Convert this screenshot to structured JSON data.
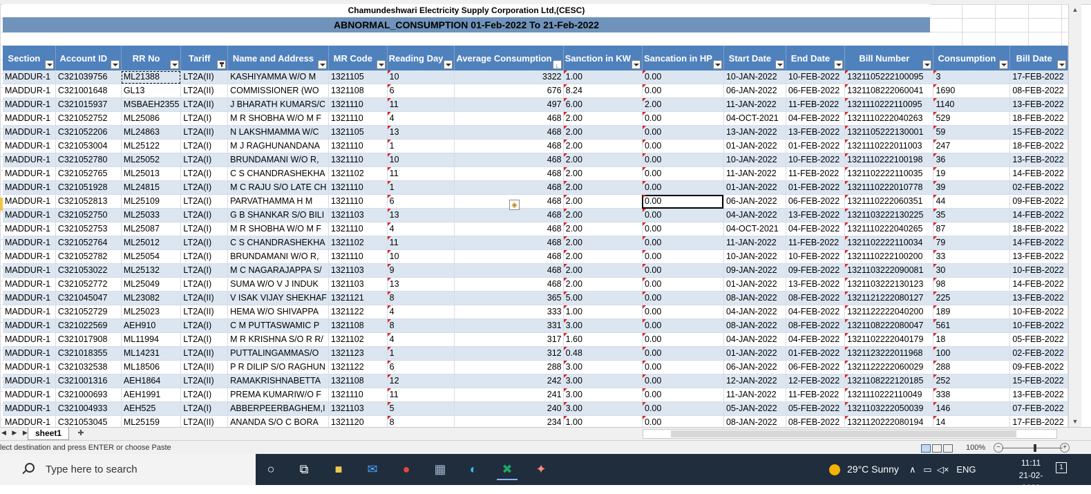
{
  "report": {
    "company": "Chamundeshwari Electricity Supply Corporation Ltd,(CESC)",
    "title": "ABNORMAL_CONSUMPTION 01-Feb-2022 To 21-Feb-2022"
  },
  "columns": [
    {
      "label": "Section",
      "filter": "normal"
    },
    {
      "label": "Account ID",
      "filter": "normal"
    },
    {
      "label": "RR No",
      "filter": "normal"
    },
    {
      "label": "Tariff",
      "filter": "active"
    },
    {
      "label": "Name and Address",
      "filter": "normal"
    },
    {
      "label": "MR Code",
      "filter": "normal"
    },
    {
      "label": "Reading Day",
      "filter": "normal"
    },
    {
      "label": "Average Consumption",
      "filter": "sorted"
    },
    {
      "label": "Sanction in KW",
      "filter": "normal"
    },
    {
      "label": "Sancation in HP",
      "filter": "normal"
    },
    {
      "label": "Start Date",
      "filter": "normal"
    },
    {
      "label": "End Date",
      "filter": "normal"
    },
    {
      "label": "Bill Number",
      "filter": "normal"
    },
    {
      "label": "Consumption",
      "filter": "normal"
    },
    {
      "label": "Bill Date",
      "filter": "normal"
    }
  ],
  "rows": [
    [
      "MADDUR-1",
      "C321039756",
      "ML21388",
      "LT2A(II)",
      "KASHIYAMMA W/O M",
      "1321105",
      "10",
      "3322",
      "1.00",
      "0.00",
      "10-JAN-2022",
      "10-FEB-2022",
      "1321105222100095",
      "3",
      "17-FEB-2022"
    ],
    [
      "MADDUR-1",
      "C321001648",
      "GL13",
      "LT2A(II)",
      "COMMISSIONER (WO",
      "1321108",
      "6",
      "676",
      "8.24",
      "0.00",
      "06-JAN-2022",
      "06-FEB-2022",
      "1321108222060041",
      "1690",
      "08-FEB-2022"
    ],
    [
      "MADDUR-1",
      "C321015937",
      "MSBAEH2355",
      "LT2A(II)",
      "J BHARATH KUMARS/C",
      "1321110",
      "11",
      "497",
      "6.00",
      "2.00",
      "11-JAN-2022",
      "11-FEB-2022",
      "1321110222110095",
      "1140",
      "13-FEB-2022"
    ],
    [
      "MADDUR-1",
      "C321052752",
      "ML25086",
      "LT2A(I)",
      "M R SHOBHA W/O M F",
      "1321110",
      "4",
      "468",
      "2.00",
      "0.00",
      "04-OCT-2021",
      "04-FEB-2022",
      "1321110222040263",
      "529",
      "18-FEB-2022"
    ],
    [
      "MADDUR-1",
      "C321052206",
      "ML24863",
      "LT2A(II)",
      "N LAKSHMAMMA W/C",
      "1321105",
      "13",
      "468",
      "2.00",
      "0.00",
      "13-JAN-2022",
      "13-FEB-2022",
      "1321105222130001",
      "59",
      "15-FEB-2022"
    ],
    [
      "MADDUR-1",
      "C321053004",
      "ML25122",
      "LT2A(I)",
      "M J RAGHUNANDANA",
      "1321110",
      "1",
      "468",
      "2.00",
      "0.00",
      "01-JAN-2022",
      "01-FEB-2022",
      "1321110222011003",
      "247",
      "18-FEB-2022"
    ],
    [
      "MADDUR-1",
      "C321052780",
      "ML25052",
      "LT2A(I)",
      "BRUNDAMANI W/O R,",
      "1321110",
      "10",
      "468",
      "2.00",
      "0.00",
      "10-JAN-2022",
      "10-FEB-2022",
      "1321110222100198",
      "36",
      "13-FEB-2022"
    ],
    [
      "MADDUR-1",
      "C321052765",
      "ML25013",
      "LT2A(I)",
      "C S CHANDRASHEKHA",
      "1321102",
      "11",
      "468",
      "2.00",
      "0.00",
      "11-JAN-2022",
      "11-FEB-2022",
      "1321102222110035",
      "19",
      "14-FEB-2022"
    ],
    [
      "MADDUR-1",
      "C321051928",
      "ML24815",
      "LT2A(I)",
      "M C RAJU S/O LATE CH",
      "1321110",
      "1",
      "468",
      "2.00",
      "0.00",
      "01-JAN-2022",
      "01-FEB-2022",
      "1321110222010778",
      "39",
      "02-FEB-2022"
    ],
    [
      "MADDUR-1",
      "C321052813",
      "ML25109",
      "LT2A(I)",
      "PARVATHAMMA H M",
      "1321110",
      "6",
      "468",
      "2.00",
      "0.00",
      "06-JAN-2022",
      "06-FEB-2022",
      "1321110222060351",
      "44",
      "09-FEB-2022"
    ],
    [
      "MADDUR-1",
      "C321052750",
      "ML25033",
      "LT2A(I)",
      "G B SHANKAR S/O BILI",
      "1321103",
      "13",
      "468",
      "2.00",
      "0.00",
      "04-JAN-2022",
      "13-FEB-2022",
      "1321103222130225",
      "35",
      "14-FEB-2022"
    ],
    [
      "MADDUR-1",
      "C321052753",
      "ML25087",
      "LT2A(I)",
      "M R SHOBHA W/O M F",
      "1321110",
      "4",
      "468",
      "2.00",
      "0.00",
      "04-OCT-2021",
      "04-FEB-2022",
      "1321110222040265",
      "87",
      "18-FEB-2022"
    ],
    [
      "MADDUR-1",
      "C321052764",
      "ML25012",
      "LT2A(I)",
      "C S CHANDRASHEKHA",
      "1321102",
      "11",
      "468",
      "2.00",
      "0.00",
      "11-JAN-2022",
      "11-FEB-2022",
      "1321102222110034",
      "79",
      "14-FEB-2022"
    ],
    [
      "MADDUR-1",
      "C321052782",
      "ML25054",
      "LT2A(I)",
      "BRUNDAMANI W/O R,",
      "1321110",
      "10",
      "468",
      "2.00",
      "0.00",
      "10-JAN-2022",
      "10-FEB-2022",
      "1321110222100200",
      "33",
      "13-FEB-2022"
    ],
    [
      "MADDUR-1",
      "C321053022",
      "ML25132",
      "LT2A(I)",
      "M C NAGARAJAPPA S/",
      "1321103",
      "9",
      "468",
      "2.00",
      "0.00",
      "09-JAN-2022",
      "09-FEB-2022",
      "1321103222090081",
      "30",
      "10-FEB-2022"
    ],
    [
      "MADDUR-1",
      "C321052772",
      "ML25049",
      "LT2A(I)",
      "SUMA W/O V J INDUK",
      "1321103",
      "13",
      "468",
      "2.00",
      "0.00",
      "01-JAN-2022",
      "13-FEB-2022",
      "1321103222130123",
      "98",
      "14-FEB-2022"
    ],
    [
      "MADDUR-1",
      "C321045047",
      "ML23082",
      "LT2A(II)",
      "V ISAK VIJAY SHEKHAF",
      "1321121",
      "8",
      "365",
      "5.00",
      "0.00",
      "08-JAN-2022",
      "08-FEB-2022",
      "1321121222080127",
      "225",
      "13-FEB-2022"
    ],
    [
      "MADDUR-1",
      "C321052729",
      "ML25023",
      "LT2A(II)",
      "HEMA W/O SHIVAPPA",
      "1321122",
      "4",
      "333",
      "1.00",
      "0.00",
      "04-JAN-2022",
      "04-FEB-2022",
      "1321122222040200",
      "189",
      "10-FEB-2022"
    ],
    [
      "MADDUR-1",
      "C321022569",
      "AEH910",
      "LT2A(I)",
      "C M PUTTASWAMIC P",
      "1321108",
      "8",
      "331",
      "3.00",
      "0.00",
      "08-JAN-2022",
      "08-FEB-2022",
      "1321108222080047",
      "561",
      "10-FEB-2022"
    ],
    [
      "MADDUR-1",
      "C321017908",
      "ML11994",
      "LT2A(I)",
      "M R KRISHNA S/O R R/",
      "1321102",
      "4",
      "317",
      "1.60",
      "0.00",
      "04-JAN-2022",
      "04-FEB-2022",
      "1321102222040179",
      "18",
      "05-FEB-2022"
    ],
    [
      "MADDUR-1",
      "C321018355",
      "ML14231",
      "LT2A(II)",
      "PUTTALINGAMMAS/O",
      "1321123",
      "1",
      "312",
      "0.48",
      "0.00",
      "01-JAN-2022",
      "01-FEB-2022",
      "1321123222011968",
      "100",
      "02-FEB-2022"
    ],
    [
      "MADDUR-1",
      "C321032538",
      "ML18506",
      "LT2A(II)",
      "P R DILIP S/O RAGHUN",
      "1321122",
      "6",
      "288",
      "3.00",
      "0.00",
      "06-JAN-2022",
      "06-FEB-2022",
      "1321122222060029",
      "288",
      "09-FEB-2022"
    ],
    [
      "MADDUR-1",
      "C321001316",
      "AEH1864",
      "LT2A(II)",
      "RAMAKRISHNABETTA",
      "1321108",
      "12",
      "242",
      "3.00",
      "0.00",
      "12-JAN-2022",
      "12-FEB-2022",
      "1321108222120185",
      "252",
      "15-FEB-2022"
    ],
    [
      "MADDUR-1",
      "C321000693",
      "AEH1991",
      "LT2A(I)",
      "PREMA KUMARIW/O F",
      "1321110",
      "11",
      "241",
      "3.00",
      "0.00",
      "11-JAN-2022",
      "11-FEB-2022",
      "1321110222110049",
      "338",
      "13-FEB-2022"
    ],
    [
      "MADDUR-1",
      "C321004933",
      "AEH525",
      "LT2A(I)",
      "ABBERPEERBAGHEM,I",
      "1321103",
      "5",
      "240",
      "3.00",
      "0.00",
      "05-JAN-2022",
      "05-FEB-2022",
      "1321103222050039",
      "146",
      "07-FEB-2022"
    ],
    [
      "MADDUR-1",
      "C321053045",
      "ML25159",
      "LT2A(II)",
      "ANANDA S/O C BORA",
      "1321120",
      "8",
      "234",
      "1.00",
      "0.00",
      "08-JAN-2022",
      "08-FEB-2022",
      "1321120222080194",
      "14",
      "17-FEB-2022"
    ]
  ],
  "sheet": {
    "tab": "sheet1"
  },
  "status": {
    "message": "lect destination and press ENTER or choose Paste",
    "zoom": "100%"
  },
  "taskbar": {
    "search_placeholder": "Type here to search",
    "weather": "29°C  Sunny",
    "lang": "ENG",
    "time": "11:11",
    "date": "21-02-2022",
    "notif_count": "1"
  },
  "colors": {
    "header_bg": "#4f81bd",
    "title_bg": "#6f93ba",
    "band": "#dce6f1",
    "taskbar": "#1f2d3d"
  }
}
